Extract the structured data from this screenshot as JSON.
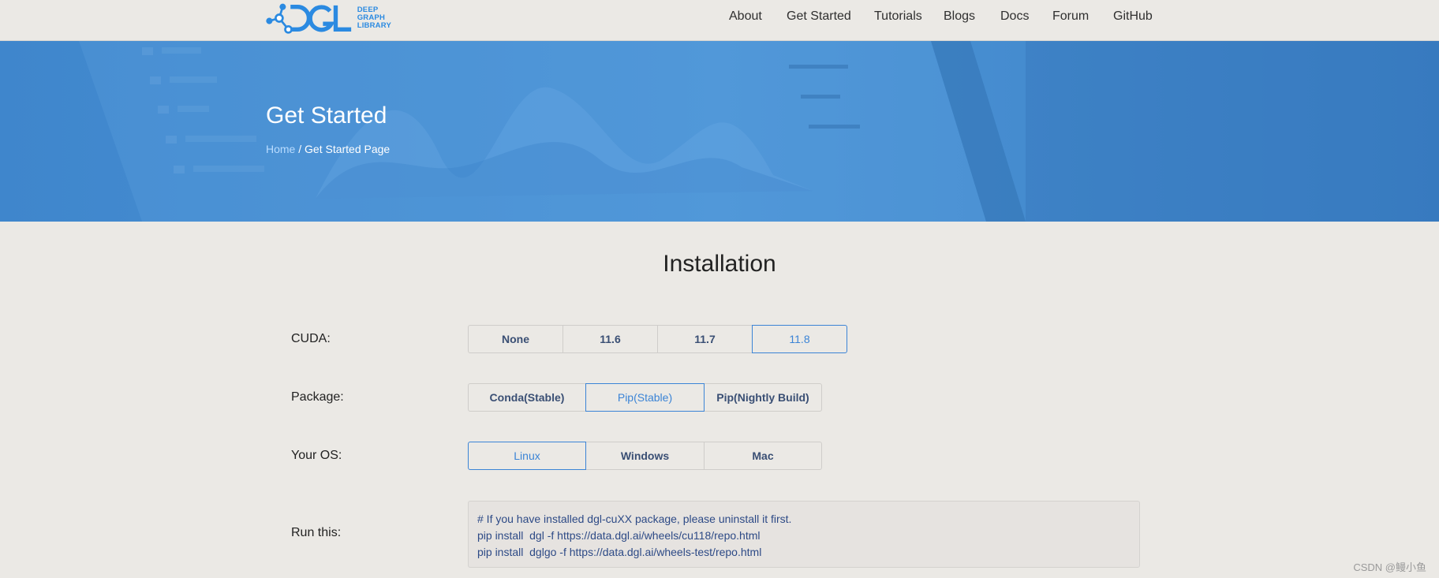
{
  "header": {
    "logo_lines": [
      "DEEP",
      "GRAPH",
      "LIBRARY"
    ],
    "logo_mark": "DGL",
    "nav": [
      {
        "label": "About"
      },
      {
        "label": "Get Started"
      },
      {
        "label": "Tutorials"
      },
      {
        "label": "Blogs"
      },
      {
        "label": "Docs"
      },
      {
        "label": "Forum"
      },
      {
        "label": "GitHub"
      }
    ]
  },
  "hero": {
    "title": "Get Started",
    "breadcrumb_home": "Home",
    "breadcrumb_sep": " / ",
    "breadcrumb_current": "Get Started Page"
  },
  "installation": {
    "title": "Installation",
    "cuda": {
      "label": "CUDA:",
      "options": [
        "None",
        "11.6",
        "11.7",
        "11.8"
      ],
      "selected": "11.8"
    },
    "package": {
      "label": "Package:",
      "options": [
        "Conda(Stable)",
        "Pip(Stable)",
        "Pip(Nightly Build)"
      ],
      "selected": "Pip(Stable)"
    },
    "os": {
      "label": "Your OS:",
      "options": [
        "Linux",
        "Windows",
        "Mac"
      ],
      "selected": "Linux"
    },
    "run": {
      "label": "Run this:",
      "lines": [
        "# If you have installed dgl-cuXX package, please uninstall it first.",
        "pip install  dgl -f https://data.dgl.ai/wheels/cu118/repo.html",
        "pip install  dglgo -f https://data.dgl.ai/wheels-test/repo.html"
      ]
    }
  },
  "watermark": "CSDN @鳗小鱼",
  "colors": {
    "accent": "#3b84d6",
    "hero_bg": "#4a90d4",
    "page_bg": "#ebe9e5"
  }
}
